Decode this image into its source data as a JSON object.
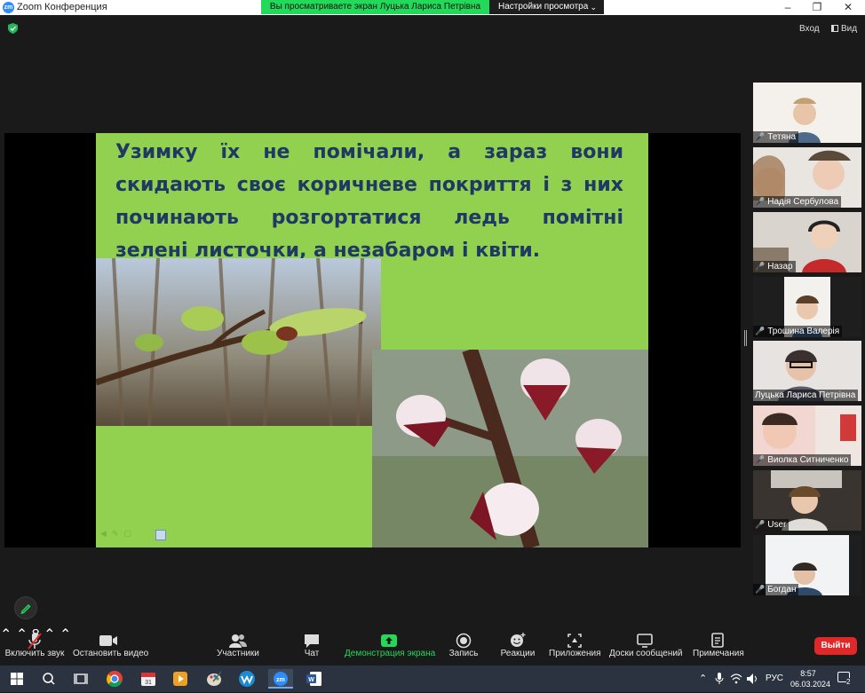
{
  "window": {
    "app_icon": "zm",
    "title": "Zoom Конференция",
    "share_banner": "Вы просматриваете экран Луцька Лариса Петрівна",
    "view_settings": "Настройки просмотра"
  },
  "top_bar": {
    "exit_fullscreen": "Вход",
    "view": "Вид"
  },
  "slide": {
    "text": "Узимку їх не помічали, а зараз вони скидають своє коричневе покриття і з них починають розгортатися ледь помітні зелені листочки, а незабаром і квіти.",
    "background": "#92d050",
    "text_color": "#1f3864"
  },
  "participants": [
    {
      "name": "Тетяна",
      "muted": true
    },
    {
      "name": "Надія Сербулова",
      "muted": true
    },
    {
      "name": "Назар",
      "muted": true
    },
    {
      "name": "Трошина Валерія",
      "muted": true
    },
    {
      "name": "Луцька Лариса Петрівна",
      "muted": false,
      "active": true
    },
    {
      "name": "Виолка Ситниченко",
      "muted": true
    },
    {
      "name": "User",
      "muted": true
    },
    {
      "name": "Богдан",
      "muted": true
    }
  ],
  "toolbar": {
    "unmute": "Включить звук",
    "start_video": "Остановить видео",
    "participants": "Участники",
    "participants_count": "8",
    "chat": "Чат",
    "share_screen": "Демонстрация экрана",
    "record": "Запись",
    "reactions": "Реакции",
    "apps": "Приложения",
    "whiteboards": "Доски сообщений",
    "notes": "Примечания",
    "leave": "Выйти"
  },
  "taskbar": {
    "language": "РУС",
    "time": "8:57",
    "date": "06.03.2024",
    "notifications": "2"
  },
  "colors": {
    "share_green": "#23d959",
    "leave_red": "#e02828",
    "active_speaker": "#d7e24a"
  }
}
